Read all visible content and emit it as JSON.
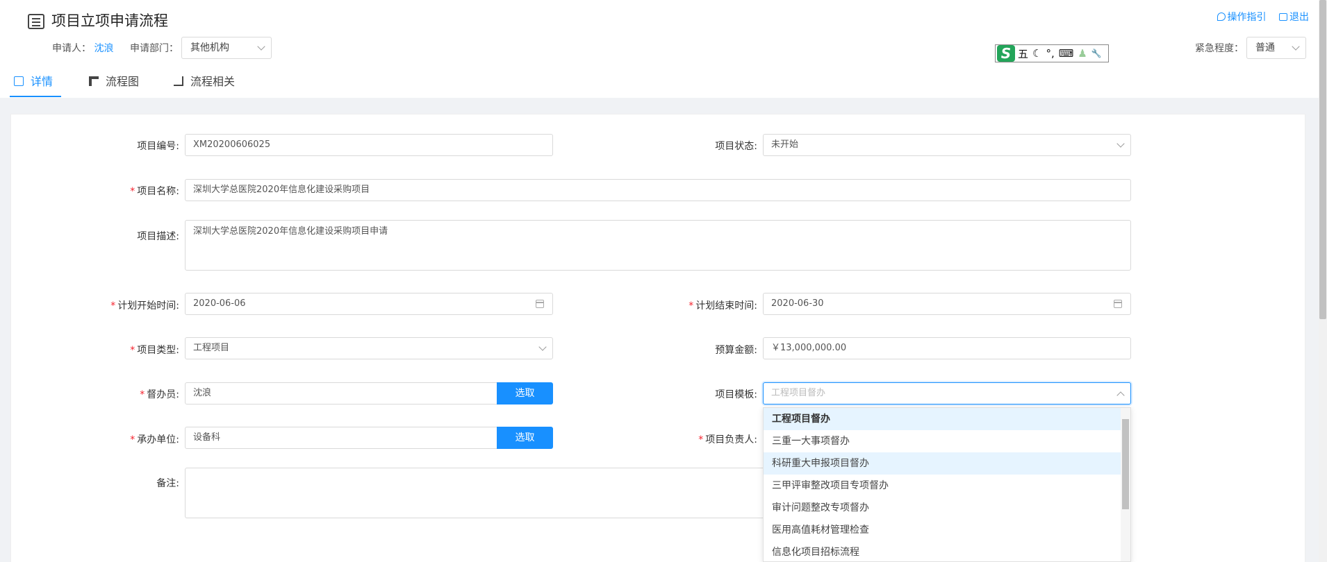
{
  "header": {
    "title": "项目立项申请流程",
    "applicant_label": "申请人：",
    "applicant": "沈浪",
    "dept_label": "申请部门：",
    "dept": "其他机构",
    "urgency_label": "紧急程度：",
    "urgency": "普通",
    "guide_link": "操作指引",
    "exit_link": "退出"
  },
  "ime": {
    "logo": "S",
    "mode": "五",
    "moon": "☾",
    "punct": "°,",
    "keyboard": "⌨",
    "user": "♟",
    "tool": "🔧"
  },
  "tabs": [
    {
      "label": "详情"
    },
    {
      "label": "流程图"
    },
    {
      "label": "流程相关"
    }
  ],
  "form": {
    "project_no": {
      "label": "项目编号:",
      "value": "XM20200606025"
    },
    "project_status": {
      "label": "项目状态:",
      "value": "未开始"
    },
    "project_name": {
      "label": "项目名称:",
      "value": "深圳大学总医院2020年信息化建设采购项目"
    },
    "project_desc": {
      "label": "项目描述:",
      "value": "深圳大学总医院2020年信息化建设采购项目申请"
    },
    "start_date": {
      "label": "计划开始时间:",
      "value": "2020-06-06"
    },
    "end_date": {
      "label": "计划结束时间:",
      "value": "2020-06-30"
    },
    "project_type": {
      "label": "项目类型:",
      "value": "工程项目"
    },
    "budget": {
      "label": "预算金额:",
      "value": "￥13,000,000.00"
    },
    "supervisor": {
      "label": "督办员:",
      "value": "沈浪",
      "button": "选取"
    },
    "template": {
      "label": "项目模板:",
      "placeholder": "工程项目督办"
    },
    "undertaker": {
      "label": "承办单位:",
      "value": "设备科",
      "button": "选取"
    },
    "leader": {
      "label": "项目负责人:"
    },
    "remark": {
      "label": "备注:"
    }
  },
  "template_options": [
    "工程项目督办",
    "三重一大事项督办",
    "科研重大申报项目督办",
    "三甲评审整改项目专项督办",
    "审计问题整改专项督办",
    "医用高值耗材管理检查",
    "信息化项目招标流程"
  ],
  "required_mark": "*"
}
